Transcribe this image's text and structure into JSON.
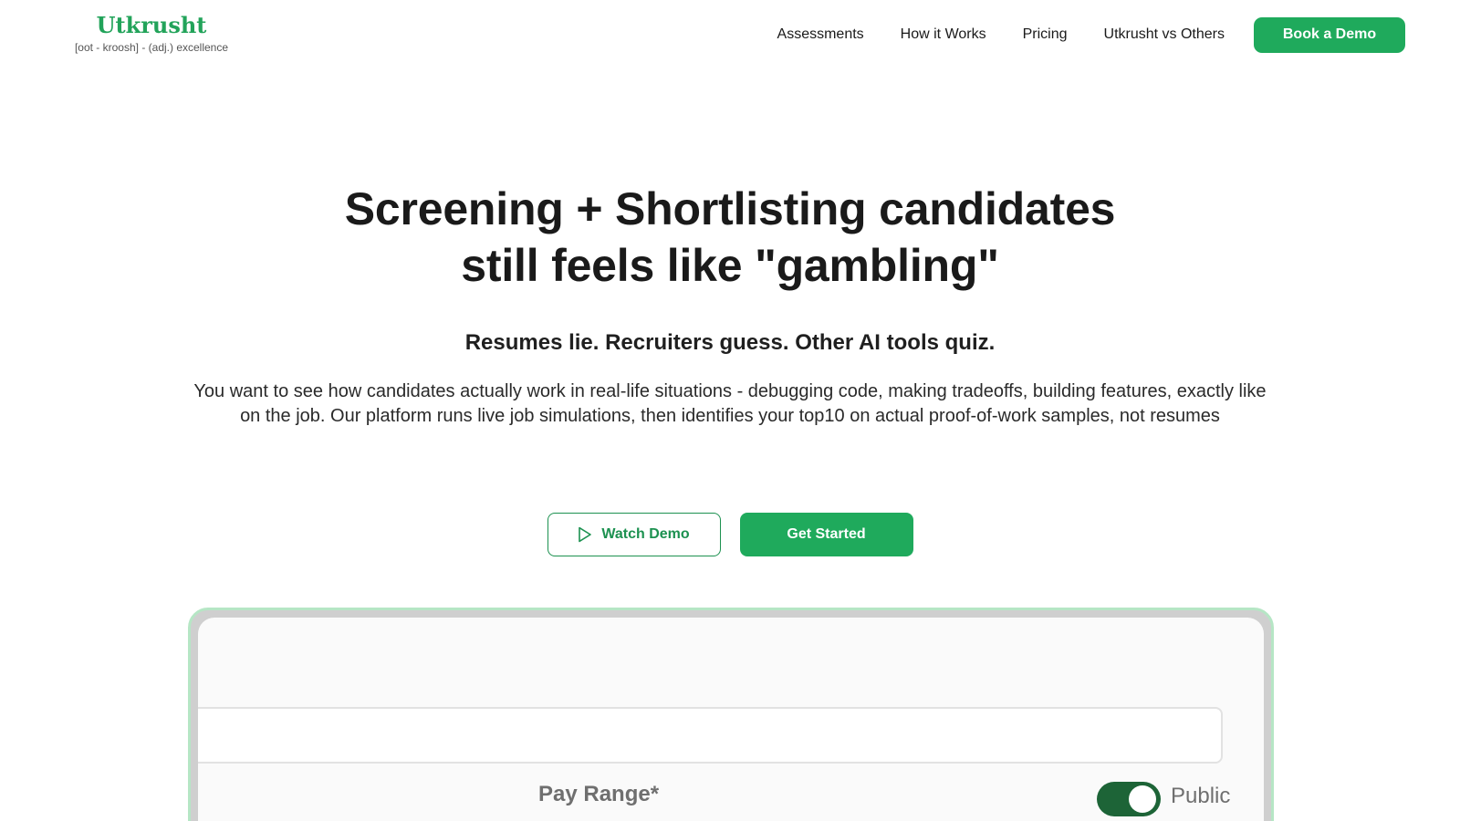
{
  "header": {
    "logo_title": "Utkrusht",
    "logo_subtitle": "[oot - kroosh] - (adj.) excellence",
    "nav": [
      "Assessments",
      "How it Works",
      "Pricing",
      "Utkrusht vs Others"
    ],
    "cta_label": "Book a Demo"
  },
  "hero": {
    "title_line1": "Screening + Shortlisting candidates",
    "title_line2": "still feels like \"gambling\"",
    "subheadline": "Resumes lie. Recruiters guess. Other AI tools quiz.",
    "description": "You want to see how candidates actually work in real-life situations - debugging code, making tradeoffs, building features, exactly like on the job. Our platform runs live job simulations, then identifies your top10 on actual proof-of-work samples, not resumes",
    "watch_demo_label": "Watch Demo",
    "get_started_label": "Get Started"
  },
  "preview": {
    "field_label": "Pay Range*",
    "toggle_state": "on",
    "toggle_label": "Public"
  },
  "colors": {
    "brand_green": "#1faa5c",
    "logo_green": "#22a35a",
    "toggle_green": "#1d6437",
    "preview_border": "#b6e6c5"
  },
  "icons": {
    "watch_demo": "play-icon"
  }
}
